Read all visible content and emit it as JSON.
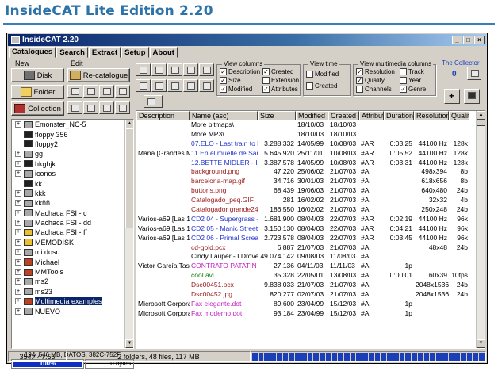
{
  "page_heading": "InsideCAT Lite Edition 2.20",
  "window": {
    "title": "InsideCAT 2.20",
    "controls": [
      "_",
      "□",
      "×"
    ]
  },
  "tabs": [
    {
      "label": "Catalogues",
      "active": true
    },
    {
      "label": "Search",
      "active": false
    },
    {
      "label": "Extract",
      "active": false
    },
    {
      "label": "Setup",
      "active": false
    },
    {
      "label": "About",
      "active": false
    }
  ],
  "new_group": {
    "label": "New",
    "buttons": [
      "Disk",
      "Folder",
      "Collection"
    ]
  },
  "edit_group": {
    "label": "Edit",
    "recatalogue": "Re-catalogue"
  },
  "view_columns": {
    "label": "View columns",
    "options": [
      {
        "label": "Description",
        "checked": true
      },
      {
        "label": "Created",
        "checked": true
      },
      {
        "label": "Size",
        "checked": true
      },
      {
        "label": "Extension",
        "checked": false
      },
      {
        "label": "Modified",
        "checked": true
      },
      {
        "label": "Attributes",
        "checked": true
      }
    ]
  },
  "view_time": {
    "label": "View time",
    "options": [
      {
        "label": "Modified",
        "checked": false
      },
      {
        "label": "Created",
        "checked": false
      }
    ]
  },
  "view_mm": {
    "label": "View multimedia columns",
    "options": [
      {
        "label": "Resolution",
        "checked": true
      },
      {
        "label": "Track",
        "checked": false
      },
      {
        "label": "Quality",
        "checked": true
      },
      {
        "label": "Year",
        "checked": false
      },
      {
        "label": "Channels",
        "checked": false
      },
      {
        "label": "Genre",
        "checked": true
      }
    ]
  },
  "collector": {
    "label": "The Collector",
    "count": "0"
  },
  "tree": [
    {
      "label": "Emonster_NC-5",
      "exp": "+",
      "type": "drive"
    },
    {
      "label": "floppy 356",
      "exp": "",
      "type": "floppy"
    },
    {
      "label": "floppy2",
      "exp": "",
      "type": "floppy"
    },
    {
      "label": "gg",
      "exp": "+",
      "type": "drive"
    },
    {
      "label": "hkghjk",
      "exp": "+",
      "type": "floppy"
    },
    {
      "label": "iconos",
      "exp": "+",
      "type": "drive"
    },
    {
      "label": "kk",
      "exp": "",
      "type": "floppy"
    },
    {
      "label": "kkk",
      "exp": "+",
      "type": "drive"
    },
    {
      "label": "kkññ",
      "exp": "+",
      "type": "drive"
    },
    {
      "label": "Machaca FSI - c",
      "exp": "+",
      "type": "drive"
    },
    {
      "label": "Machaca FSI - dd",
      "exp": "+",
      "type": "drive"
    },
    {
      "label": "Machaca FSI - ff",
      "exp": "+",
      "type": "cd"
    },
    {
      "label": "MEMODISK",
      "exp": "+",
      "type": "cd"
    },
    {
      "label": "mi dosc",
      "exp": "+",
      "type": "drive"
    },
    {
      "label": "Michael",
      "exp": "+",
      "type": "box"
    },
    {
      "label": "MMTools",
      "exp": "+",
      "type": "box"
    },
    {
      "label": "ms2",
      "exp": "+",
      "type": "drive"
    },
    {
      "label": "ms23",
      "exp": "+",
      "type": "drive"
    },
    {
      "label": "Multimedia examples",
      "exp": "+",
      "type": "box",
      "selected": true
    },
    {
      "label": "NUEVO",
      "exp": "+",
      "type": "drive"
    }
  ],
  "disk_info": "194, 546 MB, DATOS, 382C-752F",
  "progress": {
    "percent": 100,
    "label": "100%",
    "free": "0 bytes"
  },
  "grid": {
    "columns": [
      "Description",
      "Name (asc)",
      "Size",
      "Modified",
      "Created",
      "Attributes",
      "Duration",
      "Resolution",
      "Quality"
    ],
    "rows": [
      {
        "desc": "",
        "name": "More bitmaps\\",
        "size": "",
        "mod": "18/10/03",
        "cre": "18/10/03",
        "attr": "",
        "dur": "",
        "res": "",
        "q": "",
        "color": "#000000"
      },
      {
        "desc": "",
        "name": "More MP3\\",
        "size": "",
        "mod": "18/10/03",
        "cre": "18/10/03",
        "attr": "",
        "dur": "",
        "res": "",
        "q": "",
        "color": "#000000"
      },
      {
        "desc": "",
        "name": "07.ELO - Last train to L",
        "size": "3.288.332",
        "mod": "14/05/99",
        "cre": "10/08/03",
        "attr": "#AR",
        "dur": "0:03:25",
        "res": "44100 Hz",
        "q": "128k",
        "color": "#2233cc"
      },
      {
        "desc": "Maná [Grandes M",
        "name": "11 En el muelle de Sar",
        "size": "5.645.920",
        "mod": "25/11/01",
        "cre": "10/08/03",
        "attr": "#AR",
        "dur": "0:05:52",
        "res": "44100 Hz",
        "q": "128k",
        "color": "#2233cc"
      },
      {
        "desc": "",
        "name": "12.BETTE MIDLER - I",
        "size": "3.387.578",
        "mod": "14/05/99",
        "cre": "10/08/03",
        "attr": "#AR",
        "dur": "0:03:31",
        "res": "44100 Hz",
        "q": "128k",
        "color": "#2233cc"
      },
      {
        "desc": "",
        "name": "background.png",
        "size": "47.220",
        "mod": "25/06/02",
        "cre": "21/07/03",
        "attr": "#A",
        "dur": "",
        "res": "498x394",
        "q": "8b",
        "color": "#9a1a1a"
      },
      {
        "desc": "",
        "name": "barcelona-map.gif",
        "size": "34.716",
        "mod": "30/01/03",
        "cre": "21/07/03",
        "attr": "#A",
        "dur": "",
        "res": "618x656",
        "q": "8b",
        "color": "#9a1a1a"
      },
      {
        "desc": "",
        "name": "buttons.png",
        "size": "68.439",
        "mod": "19/06/03",
        "cre": "21/07/03",
        "attr": "#A",
        "dur": "",
        "res": "640x480",
        "q": "24b",
        "color": "#9a1a1a"
      },
      {
        "desc": "",
        "name": "Catalogado_peq.GIF",
        "size": "281",
        "mod": "16/02/02",
        "cre": "21/07/03",
        "attr": "#A",
        "dur": "",
        "res": "32x32",
        "q": "4b",
        "color": "#9a1a1a"
      },
      {
        "desc": "",
        "name": "Catalogador grande24.",
        "size": "186.550",
        "mod": "16/02/02",
        "cre": "21/07/03",
        "attr": "#A",
        "dur": "",
        "res": "250x248",
        "q": "24b",
        "color": "#9a1a1a"
      },
      {
        "desc": "Varios-a69 [Las 10",
        "name": "CD2 04 - Supergrass -",
        "size": "1.681.900",
        "mod": "08/04/03",
        "cre": "22/07/03",
        "attr": "#AR",
        "dur": "0:02:19",
        "res": "44100 Hz",
        "q": "96k",
        "color": "#2233cc"
      },
      {
        "desc": "Varios-a69 [Las 10",
        "name": "CD2 05 - Manic Street",
        "size": "3.150.130",
        "mod": "08/04/03",
        "cre": "22/07/03",
        "attr": "#AR",
        "dur": "0:04:21",
        "res": "44100 Hz",
        "q": "96k",
        "color": "#2233cc"
      },
      {
        "desc": "Varios-a69 [Las 10",
        "name": "CD2 06 - Primal Screar",
        "size": "2.723.578",
        "mod": "08/04/03",
        "cre": "22/07/03",
        "attr": "#AR",
        "dur": "0:03:45",
        "res": "44100 Hz",
        "q": "96k",
        "color": "#2233cc"
      },
      {
        "desc": "",
        "name": "cd-gold.pcx",
        "size": "6.887",
        "mod": "21/07/03",
        "cre": "21/07/03",
        "attr": "#A",
        "dur": "",
        "res": "48x48",
        "q": "24b",
        "color": "#9a1a1a"
      },
      {
        "desc": "",
        "name": "Cindy Lauper - I Drove",
        "size": "49.074.142",
        "mod": "09/08/03",
        "cre": "11/08/03",
        "attr": "#A",
        "dur": "",
        "res": "",
        "q": "",
        "color": "#000000"
      },
      {
        "desc": "Victor García Tasc",
        "name": "CONTRATO PATATIN",
        "size": "27.136",
        "mod": "04/11/03",
        "cre": "11/11/03",
        "attr": "#A",
        "dur": "1p",
        "res": "",
        "q": "",
        "color": "#c020c0"
      },
      {
        "desc": "",
        "name": "cool.avi",
        "size": "35.328",
        "mod": "22/05/01",
        "cre": "13/08/03",
        "attr": "#A",
        "dur": "0:00:01",
        "res": "60x39",
        "q": "10fps",
        "color": "#108010"
      },
      {
        "desc": "",
        "name": "Dsc00451.pcx",
        "size": "9.838.033",
        "mod": "21/07/03",
        "cre": "21/07/03",
        "attr": "#A",
        "dur": "",
        "res": "2048x1536",
        "q": "24b",
        "color": "#9a1a1a"
      },
      {
        "desc": "",
        "name": "Dsc00452.jpg",
        "size": "820.277",
        "mod": "02/07/03",
        "cre": "21/07/03",
        "attr": "#A",
        "dur": "",
        "res": "2048x1536",
        "q": "24b",
        "color": "#9a1a1a"
      },
      {
        "desc": "Microsoft Corporati",
        "name": "Fax elegante.dot",
        "size": "89.600",
        "mod": "23/04/99",
        "cre": "15/12/03",
        "attr": "#A",
        "dur": "1p",
        "res": "",
        "q": "",
        "color": "#c020c0"
      },
      {
        "desc": "Microsoft Corporati",
        "name": "Fax moderno.dot",
        "size": "93.184",
        "mod": "23/04/99",
        "cre": "15/12/03",
        "attr": "#A",
        "dur": "1p",
        "res": "",
        "q": "",
        "color": "#c020c0"
      }
    ]
  },
  "status": {
    "left": "354.447:55",
    "middle": "2 folders, 48 files, 117 MB",
    "blocks": 38
  }
}
